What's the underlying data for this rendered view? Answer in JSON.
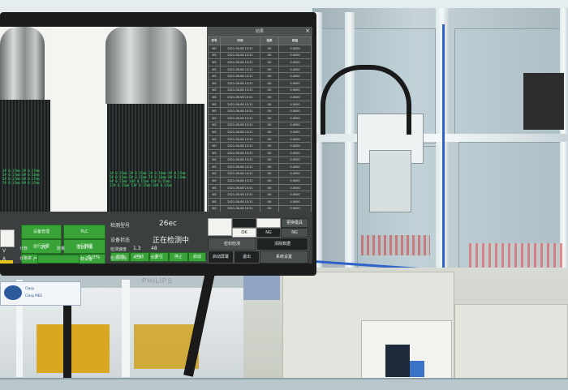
{
  "monitor": {
    "brand": "PHILIPS",
    "panel_title": "结果",
    "close_glyph": "×",
    "table": {
      "headers": [
        "序号",
        "时间",
        "结果",
        "数值"
      ],
      "rows": [
        [
          "NG",
          "2021-06-08 10:21",
          "OK",
          "0.0000"
        ],
        [
          "NG",
          "2021-06-08 10:21",
          "OK",
          "0.0000"
        ],
        [
          "NG",
          "2021-06-08 10:21",
          "OK",
          "0.0000"
        ],
        [
          "NG",
          "2021-06-08 10:21",
          "OK",
          "0.0000"
        ],
        [
          "NG",
          "2021-06-08 10:21",
          "OK",
          "0.0000"
        ],
        [
          "NG",
          "2021-06-08 10:21",
          "OK",
          "0.0000"
        ],
        [
          "NG",
          "2021-06-08 10:21",
          "OK",
          "0.0000"
        ],
        [
          "NG",
          "2021-06-08 10:21",
          "OK",
          "0.0000"
        ],
        [
          "NG",
          "2021-06-08 10:21",
          "OK",
          "0.0000"
        ],
        [
          "NG",
          "2021-06-08 10:21",
          "OK",
          "0.0000"
        ],
        [
          "NG",
          "2021-06-08 10:21",
          "OK",
          "0.0000"
        ],
        [
          "NG",
          "2021-06-08 10:21",
          "OK",
          "0.0000"
        ],
        [
          "NG",
          "2021-06-08 10:21",
          "OK",
          "0.0000"
        ],
        [
          "NG",
          "2021-06-08 10:21",
          "OK",
          "0.0000"
        ],
        [
          "NG",
          "2021-06-08 10:21",
          "OK",
          "0.0000"
        ],
        [
          "NG",
          "2021-06-08 10:21",
          "OK",
          "0.0000"
        ],
        [
          "NG",
          "2021-06-08 10:21",
          "OK",
          "0.0000"
        ],
        [
          "NG",
          "2021-06-08 10:21",
          "OK",
          "0.0000"
        ],
        [
          "NG",
          "2021-06-08 10:21",
          "OK",
          "0.0000"
        ],
        [
          "NG",
          "2021-06-08 10:21",
          "OK",
          "0.0000"
        ],
        [
          "NG",
          "2021-06-08 10:21",
          "OK",
          "0.0000"
        ],
        [
          "NG",
          "2021-06-08 10:21",
          "OK",
          "0.0000"
        ],
        [
          "NG",
          "2021-06-08 10:21",
          "OK",
          "0.0000"
        ],
        [
          "NG",
          "2021-06-08 10:21",
          "OK",
          "0.0000"
        ],
        [
          "NG",
          "2021-06-08 10:21",
          "OK",
          "0.0000"
        ]
      ]
    },
    "camera_readouts": {
      "left": [
        "1# 0.17mm   2# 0.17mm",
        "3# 0.17mm   4# 0.16mm",
        "5# 0.17mm   6# 0.17mm",
        "7# 0.17mm   8# 0.17mm"
      ],
      "right": [
        "1# 0.15mm  2# 0.15mm  3# 0.16mm  4# 0.15mm",
        "5# 0.15mm  6# 0.15mm  7# 0.16mm  8# 0.15mm",
        "9# 0.15mm  10# 0.15mm  11# 0.15mm",
        "12# 0.15mm  13# 0.15mm  14# 0.15mm"
      ]
    },
    "control": {
      "btn_top_left": "设备管理",
      "btn_top_right": "PLC",
      "btn_mid_left": "运行设置",
      "btn_mid_right": "运行数据",
      "btn_low_left": "产量统计",
      "btn_low_right": "参数设置",
      "count_label": "计数",
      "count_value": "20",
      "count_num_label": "数量",
      "count_num_value": "31978",
      "progress_label": "合格率",
      "progress_value": "0.0%",
      "side_letters": [
        "V",
        "A"
      ],
      "detect_label": "检测型号",
      "detect_value": "26ec",
      "status_label": "设备状态",
      "status_value": "正在检测中",
      "mode_buttons": [
        "自动",
        "手动",
        "复位",
        "停止",
        "启动"
      ],
      "row_a_label": "检测速度",
      "row_a_v1": "1.3",
      "row_a_v2": "48",
      "row_b_label": "检测间隔",
      "row_b_v1": "4.3",
      "row_b_v2": "65",
      "grid_buttons": [
        "",
        "",
        "",
        "更换模具",
        "OK",
        "NG",
        "NG",
        "密封检测",
        "清除数据",
        "启动屏幕",
        "退出",
        "系统设置"
      ]
    }
  },
  "sticker": {
    "line1": "Clasp",
    "line2": "Clasp MES"
  },
  "colors": {
    "screen_green": "#39a33a",
    "panel_dark": "#3b3f3f",
    "frame_blue": "#2f61c9"
  }
}
